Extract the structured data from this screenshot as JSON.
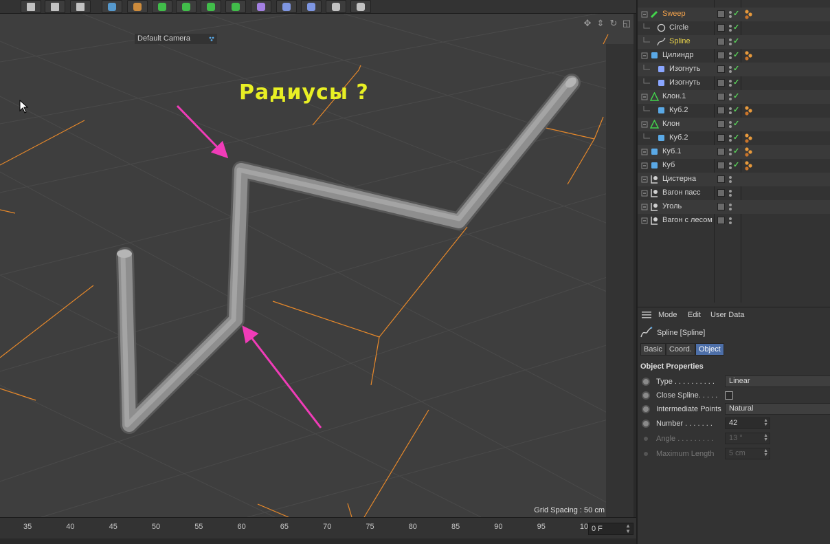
{
  "toolbar": {
    "buttons": [
      {
        "name": "render-region-icon",
        "color": "#d9d9d9"
      },
      {
        "name": "render-view-icon",
        "color": "#d9d9d9"
      },
      {
        "name": "render-settings-icon",
        "color": "#d9d9d9"
      },
      {
        "name": "cube-primitive-icon",
        "color": "#5aa9e6"
      },
      {
        "name": "pen-spline-icon",
        "color": "#e89a3c"
      },
      {
        "name": "subdivision-surface-icon",
        "color": "#42d44c"
      },
      {
        "name": "extrude-generator-icon",
        "color": "#42d44c"
      },
      {
        "name": "mograph-cloner-icon",
        "color": "#42d44c"
      },
      {
        "name": "array-icon",
        "color": "#42d44c"
      },
      {
        "name": "deformer-icon",
        "color": "#b58cff"
      },
      {
        "name": "bend-deformer-icon",
        "color": "#8aa6ff"
      },
      {
        "name": "floor-icon",
        "color": "#8aa6ff"
      },
      {
        "name": "camera-icon",
        "color": "#d9d9d9"
      },
      {
        "name": "light-icon",
        "color": "#d9d9d9"
      }
    ]
  },
  "viewport": {
    "camera_label": "Default Camera",
    "annotation": "Радиусы ?",
    "grid_spacing": "Grid Spacing : 50 cm",
    "tools": [
      "move-view-icon",
      "zoom-view-icon",
      "rotate-view-icon",
      "maximize-view-icon"
    ]
  },
  "timeline": {
    "ticks": [
      "35",
      "40",
      "45",
      "50",
      "55",
      "60",
      "65",
      "70",
      "75",
      "80",
      "85",
      "90",
      "95",
      "10"
    ],
    "frame_field": "0 F"
  },
  "object_manager": {
    "objects": [
      {
        "name": "Sweep",
        "icon": "sweep-icon",
        "color": "orange",
        "indent": 0,
        "has_tag": true
      },
      {
        "name": "Circle",
        "icon": "circle-spline-icon",
        "color": "normal",
        "indent": 1,
        "has_tag": false
      },
      {
        "name": "Spline",
        "icon": "spline-icon",
        "color": "yellow",
        "indent": 1,
        "has_tag": false
      },
      {
        "name": "Цилиндр",
        "icon": "cylinder-icon",
        "color": "normal",
        "indent": 0,
        "has_tag": true
      },
      {
        "name": "Изогнуть",
        "icon": "bend-icon",
        "color": "normal",
        "indent": 1,
        "has_tag": false
      },
      {
        "name": "Изогнуть",
        "icon": "bend-icon",
        "color": "normal",
        "indent": 1,
        "has_tag": false
      },
      {
        "name": "Клон.1",
        "icon": "cloner-icon",
        "color": "normal",
        "indent": 0,
        "has_tag": false
      },
      {
        "name": "Куб.2",
        "icon": "cube-icon",
        "color": "normal",
        "indent": 1,
        "has_tag": true
      },
      {
        "name": "Клон",
        "icon": "cloner-icon",
        "color": "normal",
        "indent": 0,
        "has_tag": false
      },
      {
        "name": "Куб.2",
        "icon": "cube-icon",
        "color": "normal",
        "indent": 1,
        "has_tag": true
      },
      {
        "name": "Куб.1",
        "icon": "cube-icon",
        "color": "normal",
        "indent": 0,
        "has_tag": true
      },
      {
        "name": "Куб",
        "icon": "cube-icon",
        "color": "normal",
        "indent": 0,
        "has_tag": true
      },
      {
        "name": "Цистерна",
        "icon": "null-icon",
        "color": "normal",
        "indent": 0,
        "has_tag": false
      },
      {
        "name": "Вагон пасс",
        "icon": "null-icon",
        "color": "normal",
        "indent": 0,
        "has_tag": false
      },
      {
        "name": "Уголь",
        "icon": "null-icon",
        "color": "normal",
        "indent": 0,
        "has_tag": false
      },
      {
        "name": "Вагон с лесом",
        "icon": "null-icon",
        "color": "normal",
        "indent": 0,
        "has_tag": false
      }
    ]
  },
  "attribute_manager": {
    "menu": [
      "Mode",
      "Edit",
      "User Data"
    ],
    "title": "Spline [Spline]",
    "tabs": [
      {
        "label": "Basic",
        "active": false
      },
      {
        "label": "Coord.",
        "active": false
      },
      {
        "label": "Object",
        "active": true
      }
    ],
    "section": "Object Properties",
    "props": {
      "type": {
        "label": "Type . . . . . . . . . .",
        "value": "Linear"
      },
      "close_spline": {
        "label": "Close Spline. . . . .",
        "value": false
      },
      "intermediate": {
        "label": "Intermediate Points",
        "value": "Natural"
      },
      "number": {
        "label": "Number . . . . . . .",
        "value": "42"
      },
      "angle": {
        "label": "Angle . . . . . . . . .",
        "value": "13 °"
      },
      "max_length": {
        "label": "Maximum Length",
        "value": "5 cm"
      }
    }
  },
  "colors": {
    "accent_tab": "#4d6fa8",
    "grid_orange": "#e8892a",
    "arrow_pink": "#f03cb8",
    "annotation_yellow": "#e8ef24",
    "check_green": "#5ad25a"
  }
}
